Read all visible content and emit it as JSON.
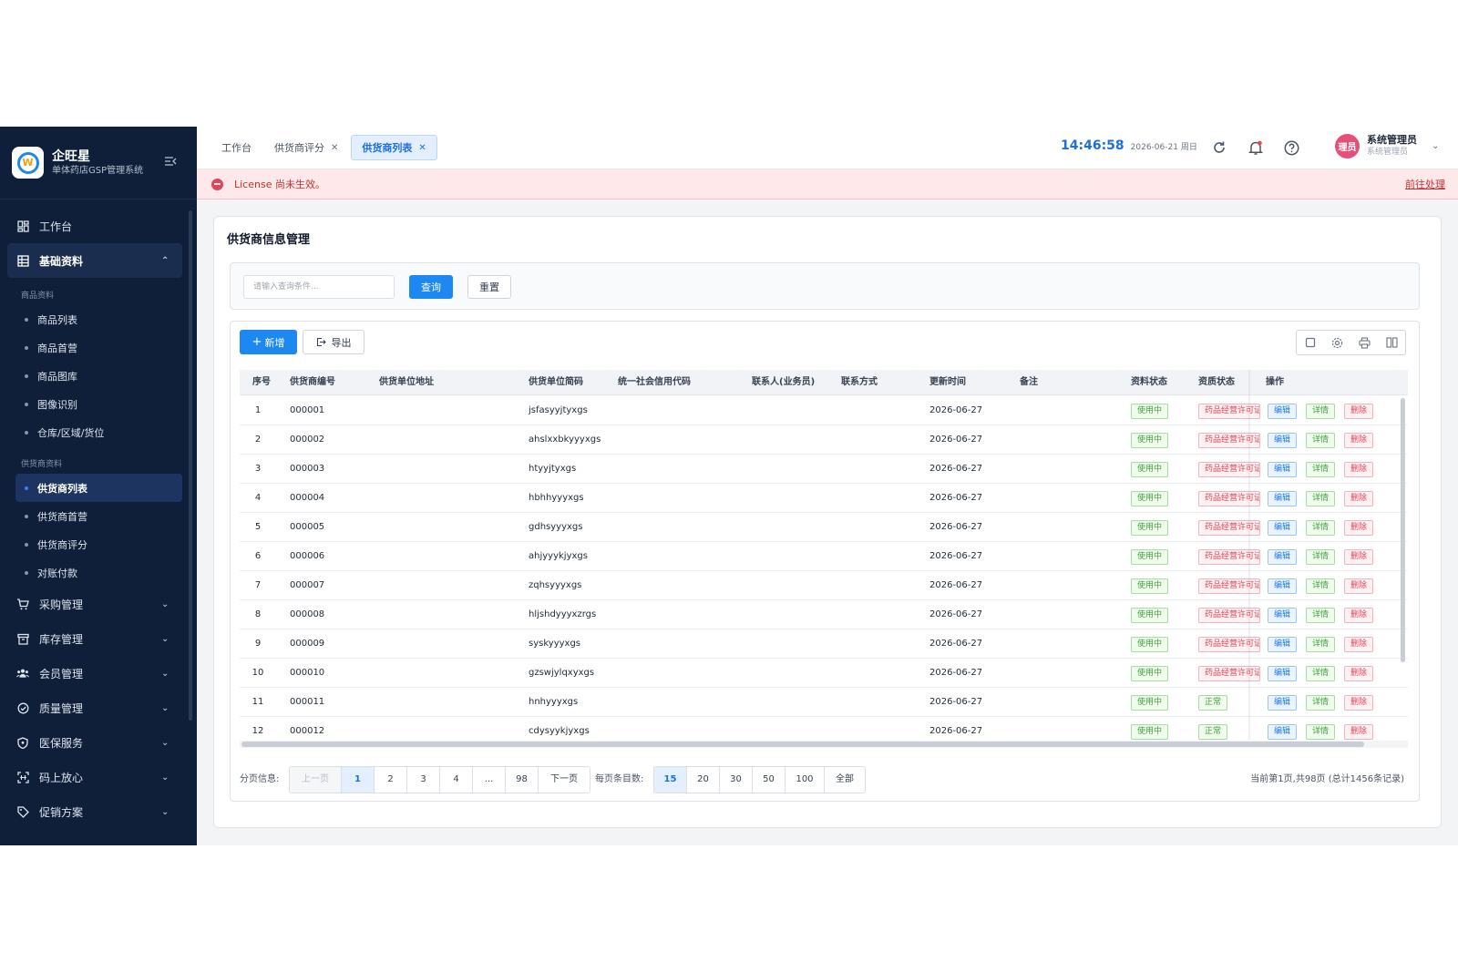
{
  "brand": {
    "name": "企旺星",
    "subtitle": "单体药店GSP管理系统"
  },
  "sidebar": {
    "workbench": "工作台",
    "basic": "基础资料",
    "group_goods": "商品资料",
    "goods_items": [
      "商品列表",
      "商品首营",
      "商品图库",
      "图像识别",
      "仓库/区域/货位"
    ],
    "group_supplier": "供货商资料",
    "supplier_items": [
      "供货商列表",
      "供货商首营",
      "供货商评分",
      "对账付款"
    ],
    "modules": [
      "采购管理",
      "库存管理",
      "会员管理",
      "质量管理",
      "医保服务",
      "码上放心",
      "促销方案"
    ]
  },
  "tabs": [
    {
      "label": "工作台"
    },
    {
      "label": "供货商评分"
    },
    {
      "label": "供货商列表"
    }
  ],
  "header": {
    "time": "14:46:58",
    "date": "2026-06-21 周日",
    "user_name": "系统管理员",
    "user_role": "系统管理员",
    "avatar_text": "理员"
  },
  "alert": {
    "message": "License 尚未生效。",
    "link": "前往处理"
  },
  "page": {
    "title": "供货商信息管理"
  },
  "search": {
    "placeholder": "请输入查询条件...",
    "query": "查询",
    "reset": "重置"
  },
  "toolbar": {
    "add": "新增",
    "export": "导出"
  },
  "table": {
    "columns": [
      "序号",
      "供货商编号",
      "供货单位地址",
      "供货单位简码",
      "统一社会信用代码",
      "联系人(业务员)",
      "联系方式",
      "更新时间",
      "备注",
      "资料状态",
      "资质状态",
      "操作"
    ],
    "ops": {
      "edit": "编辑",
      "detail": "详情",
      "delete": "删除"
    },
    "rows": [
      {
        "no": "1",
        "code": "000001",
        "abbr": "jsfasyyjtyxgs",
        "updated": "2026-06-27",
        "status": "使用中",
        "qual": "药品经营许可证",
        "qual_ok": false
      },
      {
        "no": "2",
        "code": "000002",
        "abbr": "ahslxxbkyyyxgs",
        "updated": "2026-06-27",
        "status": "使用中",
        "qual": "药品经营许可证",
        "qual_ok": false
      },
      {
        "no": "3",
        "code": "000003",
        "abbr": "htyyjtyxgs",
        "updated": "2026-06-27",
        "status": "使用中",
        "qual": "药品经营许可证",
        "qual_ok": false
      },
      {
        "no": "4",
        "code": "000004",
        "abbr": "hbhhyyyxgs",
        "updated": "2026-06-27",
        "status": "使用中",
        "qual": "药品经营许可证",
        "qual_ok": false
      },
      {
        "no": "5",
        "code": "000005",
        "abbr": "gdhsyyyxgs",
        "updated": "2026-06-27",
        "status": "使用中",
        "qual": "药品经营许可证",
        "qual_ok": false
      },
      {
        "no": "6",
        "code": "000006",
        "abbr": "ahjyyykjyxgs",
        "updated": "2026-06-27",
        "status": "使用中",
        "qual": "药品经营许可证",
        "qual_ok": false
      },
      {
        "no": "7",
        "code": "000007",
        "abbr": "zqhsyyyxgs",
        "updated": "2026-06-27",
        "status": "使用中",
        "qual": "药品经营许可证",
        "qual_ok": false
      },
      {
        "no": "8",
        "code": "000008",
        "abbr": "hljshdyyyxzrgs",
        "updated": "2026-06-27",
        "status": "使用中",
        "qual": "药品经营许可证",
        "qual_ok": false
      },
      {
        "no": "9",
        "code": "000009",
        "abbr": "syskyyyxgs",
        "updated": "2026-06-27",
        "status": "使用中",
        "qual": "药品经营许可证",
        "qual_ok": false
      },
      {
        "no": "10",
        "code": "000010",
        "abbr": "gzswjylqxyxgs",
        "updated": "2026-06-27",
        "status": "使用中",
        "qual": "药品经营许可证",
        "qual_ok": false
      },
      {
        "no": "11",
        "code": "000011",
        "abbr": "hnhyyyxgs",
        "updated": "2026-06-27",
        "status": "使用中",
        "qual": "正常",
        "qual_ok": true
      },
      {
        "no": "12",
        "code": "000012",
        "abbr": "cdysyykjyxgs",
        "updated": "2026-06-27",
        "status": "使用中",
        "qual": "正常",
        "qual_ok": true
      }
    ]
  },
  "pager": {
    "label": "分页信息:",
    "prev": "上一页",
    "pages": [
      "1",
      "2",
      "3",
      "4",
      "...",
      "98"
    ],
    "next": "下一页",
    "size_label": "每页条目数:",
    "sizes": [
      "15",
      "20",
      "30",
      "50",
      "100",
      "全部"
    ],
    "summary": "当前第1页,共98页 (总计1456条记录)"
  },
  "colors": {
    "sidebar_bg": "#0f1f3a",
    "primary": "#1e88f2",
    "danger": "#e0455a",
    "success": "#3fa33a"
  }
}
